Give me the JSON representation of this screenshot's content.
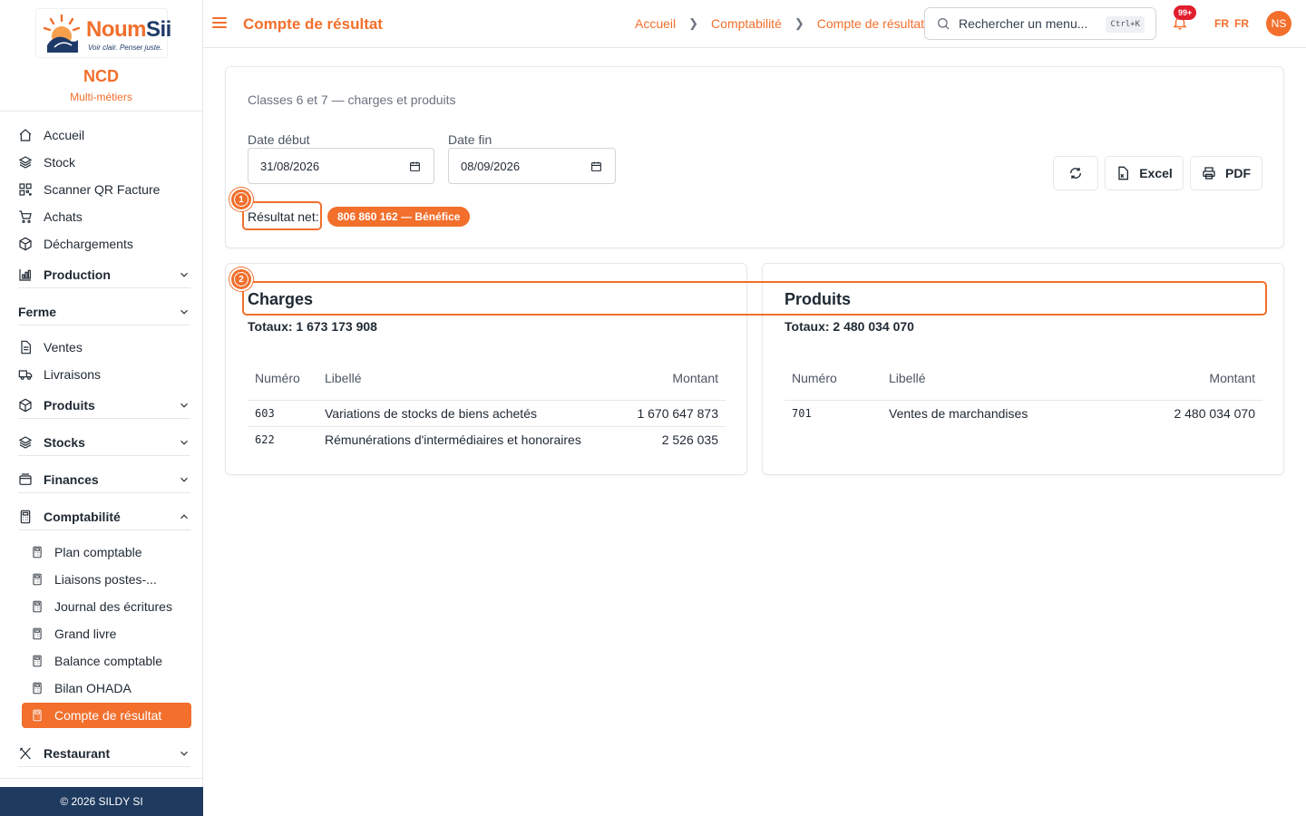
{
  "brand": {
    "logo_main": "Noum",
    "logo_accent": "Sii",
    "logo_tagline": "Voir clair. Penser juste.",
    "org_name": "NCD",
    "org_subtitle": "Multi-métiers"
  },
  "sidebar": {
    "items": [
      {
        "label": "Accueil",
        "icon": "home-icon"
      },
      {
        "label": "Stock",
        "icon": "layers-icon"
      },
      {
        "label": "Scanner QR Facture",
        "icon": "qr-icon"
      },
      {
        "label": "Achats",
        "icon": "cart-icon"
      },
      {
        "label": "Déchargements",
        "icon": "package-icon"
      }
    ],
    "groups": {
      "production": "Production",
      "ferme": "Ferme",
      "produits": "Produits",
      "stocks": "Stocks",
      "finances": "Finances",
      "comptabilite": "Comptabilité",
      "restaurant": "Restaurant"
    },
    "ferme_items": [
      {
        "label": "Ventes",
        "icon": "document-icon"
      },
      {
        "label": "Livraisons",
        "icon": "truck-icon"
      }
    ],
    "comptabilite_items": [
      "Plan comptable",
      "Liaisons postes-...",
      "Journal des écritures",
      "Grand livre",
      "Balance comptable",
      "Bilan OHADA",
      "Compte de résultat"
    ],
    "footer": "© 2026 SILDY SI"
  },
  "header": {
    "title": "Compte de résultat",
    "breadcrumb": [
      "Accueil",
      "Comptabilité",
      "Compte de résultat"
    ],
    "search_placeholder": "Rechercher un menu...",
    "search_shortcut": "Ctrl+K",
    "notifications_badge": "99+",
    "lang_1": "FR",
    "lang_2": "FR",
    "avatar_initials": "NS"
  },
  "filters": {
    "subtitle": "Classes 6 et 7 — charges et produits",
    "start_label": "Date début",
    "start_value": "31/08/2026",
    "end_label": "Date fin",
    "end_value": "08/09/2026",
    "excel_label": "Excel",
    "pdf_label": "PDF",
    "result_label": "Résultat net:",
    "result_value": "806 860 162 — Bénéfice"
  },
  "charges": {
    "title": "Charges",
    "totals": "Totaux: 1 673 173 908",
    "columns": [
      "Numéro",
      "Libellé",
      "Montant"
    ],
    "rows": [
      {
        "numero": "603",
        "libelle": "Variations de stocks de biens achetés",
        "montant": "1 670 647 873"
      },
      {
        "numero": "622",
        "libelle": "Rémunérations d'intermédiaires et honoraires",
        "montant": "2 526 035"
      }
    ]
  },
  "produits": {
    "title": "Produits",
    "totals": "Totaux: 2 480 034 070",
    "columns": [
      "Numéro",
      "Libellé",
      "Montant"
    ],
    "rows": [
      {
        "numero": "701",
        "libelle": "Ventes de marchandises",
        "montant": "2 480 034 070"
      }
    ]
  },
  "annotations": {
    "marker_1": "1",
    "marker_2": "2"
  },
  "colors": {
    "accent": "#f26f2c",
    "footer": "#1f3a5f",
    "badge": "#e11d2e"
  }
}
